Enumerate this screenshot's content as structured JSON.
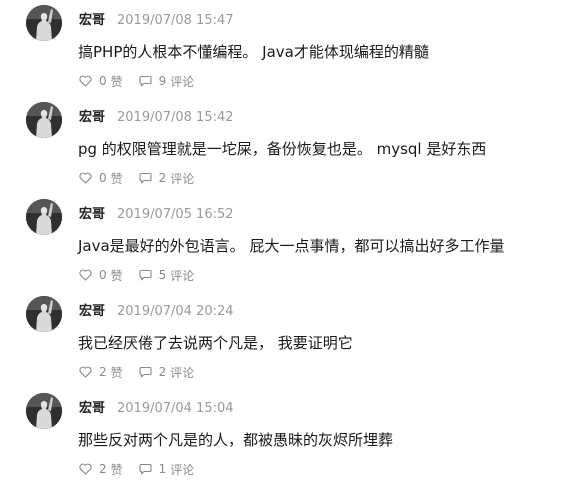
{
  "posts": [
    {
      "author": "宏哥",
      "timestamp": "2019/07/08 15:47",
      "content": "搞PHP的人根本不懂编程。 Java才能体现编程的精髓",
      "likes": "0",
      "like_label": "赞",
      "comments": "9",
      "comment_label": "评论"
    },
    {
      "author": "宏哥",
      "timestamp": "2019/07/08 15:42",
      "content": "pg 的权限管理就是一坨屎，备份恢复也是。 mysql 是好东西",
      "likes": "0",
      "like_label": "赞",
      "comments": "2",
      "comment_label": "评论"
    },
    {
      "author": "宏哥",
      "timestamp": "2019/07/05 16:52",
      "content": "Java是最好的外包语言。 屁大一点事情，都可以搞出好多工作量",
      "likes": "0",
      "like_label": "赞",
      "comments": "5",
      "comment_label": "评论"
    },
    {
      "author": "宏哥",
      "timestamp": "2019/07/04 20:24",
      "content": "我已经厌倦了去说两个凡是， 我要证明它",
      "likes": "2",
      "like_label": "赞",
      "comments": "2",
      "comment_label": "评论"
    },
    {
      "author": "宏哥",
      "timestamp": "2019/07/04 15:04",
      "content": "那些反对两个凡是的人，都被愚昧的灰烬所埋葬",
      "likes": "2",
      "like_label": "赞",
      "comments": "1",
      "comment_label": "评论"
    }
  ],
  "icons": {
    "like": "heart-icon",
    "comment": "comment-bubble-icon",
    "avatar": "statue-avatar"
  },
  "colors": {
    "author": "#222222",
    "timestamp": "#9a9a9a",
    "content": "#1a1a1a",
    "actions": "#8a8a8a"
  }
}
